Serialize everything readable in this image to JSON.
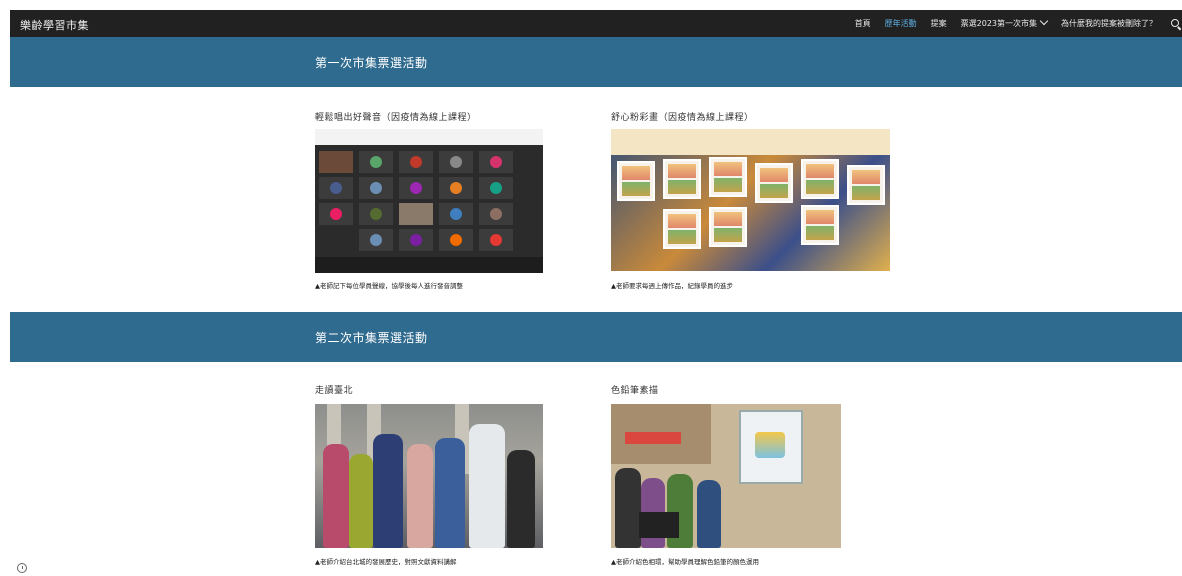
{
  "header": {
    "brand": "樂齡學習市集",
    "nav": [
      {
        "label": "首頁",
        "active": false
      },
      {
        "label": "歷年活動",
        "active": true
      },
      {
        "label": "提案",
        "active": false
      },
      {
        "label": "票選2023第一次市集",
        "active": false,
        "dropdown": true
      },
      {
        "label": "為什麼我的提案被刪除了？",
        "active": false
      }
    ],
    "search_icon": "search-icon",
    "active_color": "#5fb3e6"
  },
  "sections": [
    {
      "title": "第一次市集票選活動",
      "cards": [
        {
          "title": "輕鬆唱出好聲音（因疫情為線上課程）",
          "caption": "▲老師記下每位學員聲線，協學後每人進行發音調整"
        },
        {
          "title": "舒心粉彩畫（因疫情為線上課程）",
          "caption": "▲老師要求每週上傳作品，紀錄學員的進步"
        }
      ]
    },
    {
      "title": "第二次市集票選活動",
      "cards": [
        {
          "title": "走讀臺北",
          "caption": "▲老師介紹台北城的發展歷史，對照文獻資料講解"
        },
        {
          "title": "色鉛筆素描",
          "caption": "▲老師介紹色相環，幫助學員理解色鉛筆的顏色運用"
        }
      ]
    }
  ],
  "colors": {
    "topbar": "#212121",
    "banner": "#2f6a8f"
  }
}
